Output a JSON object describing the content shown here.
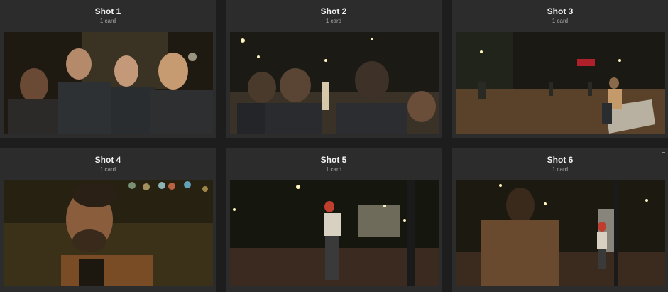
{
  "shots": [
    {
      "title": "Shot 1",
      "count": "1 card"
    },
    {
      "title": "Shot 2",
      "count": "1 card"
    },
    {
      "title": "Shot 3",
      "count": "1 card"
    },
    {
      "title": "Shot 4",
      "count": "1 card"
    },
    {
      "title": "Shot 5",
      "count": "1 card"
    },
    {
      "title": "Shot 6",
      "count": "1 card"
    }
  ]
}
